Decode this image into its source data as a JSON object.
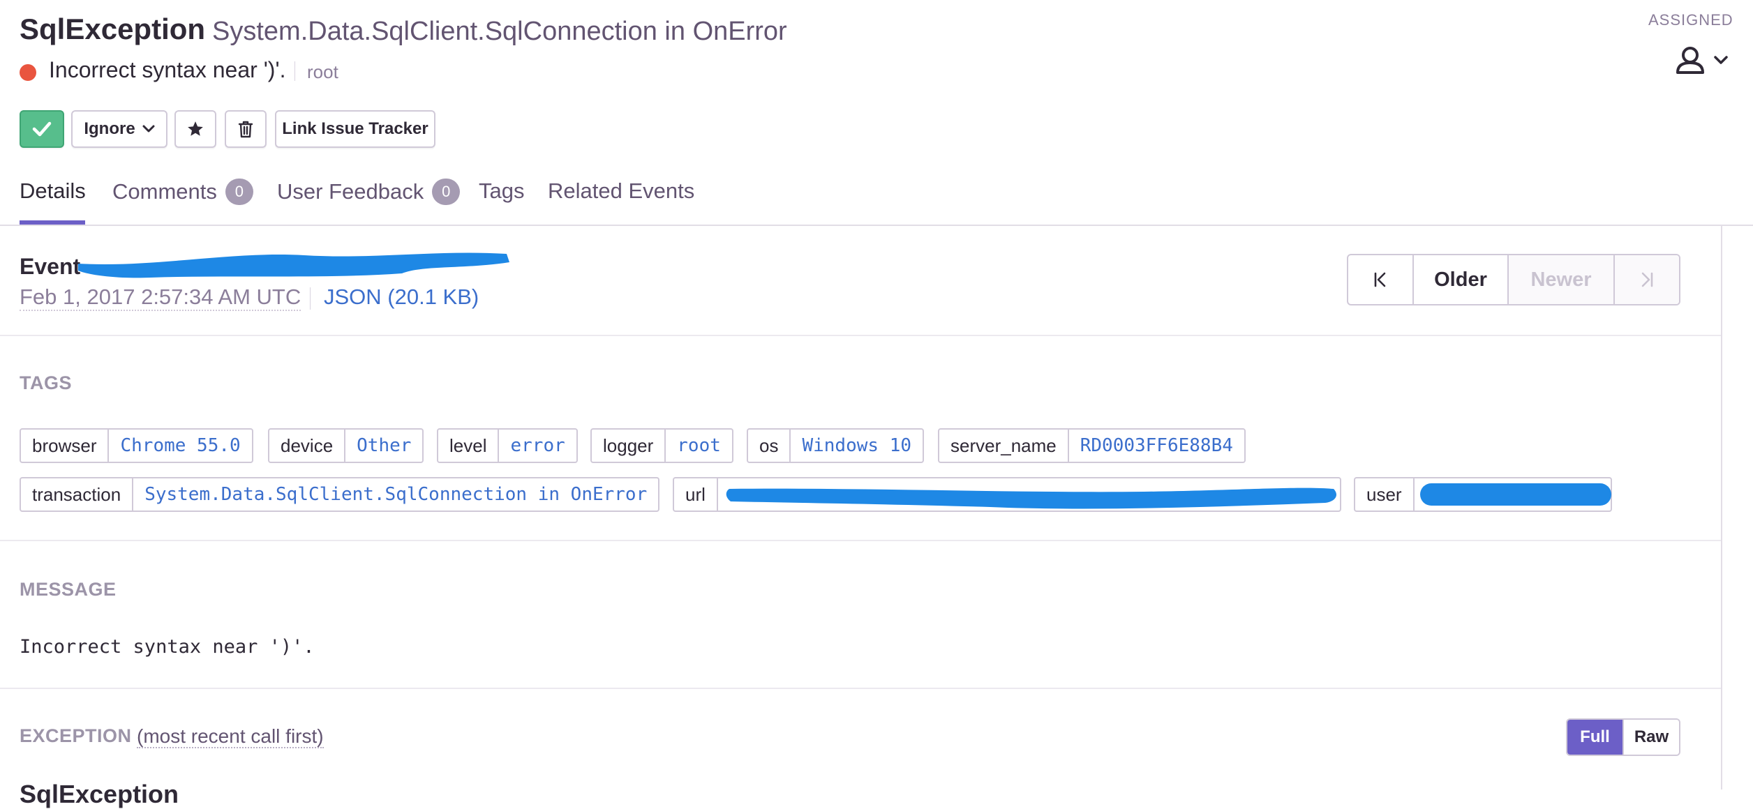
{
  "header": {
    "error_type": "SqlException",
    "culprit_title": "System.Data.SqlClient.SqlConnection in OnError",
    "message": "Incorrect syntax near ')'.",
    "logger": "root",
    "level_color": "#e9553f",
    "assigned_label": "ASSIGNED",
    "assignee_icon": "user-icon"
  },
  "actions": {
    "resolve_icon": "check-icon",
    "ignore_label": "Ignore",
    "bookmark_icon": "star-icon",
    "delete_icon": "trash-icon",
    "link_issue_label": "Link Issue Tracker",
    "resolve_color": "#57be8c"
  },
  "tabs": [
    {
      "label": "Details",
      "active": true
    },
    {
      "label": "Comments",
      "badge": "0"
    },
    {
      "label": "User Feedback",
      "badge": "0"
    },
    {
      "label": "Tags"
    },
    {
      "label": "Related Events"
    }
  ],
  "event": {
    "title": "Event",
    "date": "Feb 1, 2017 2:57:34 AM UTC",
    "json_link": "JSON (20.1 KB)",
    "pager": {
      "older": "Older",
      "newer": "Newer"
    }
  },
  "tags_section": {
    "title": "TAGS",
    "tags": [
      {
        "key": "browser",
        "value": "Chrome 55.0"
      },
      {
        "key": "device",
        "value": "Other"
      },
      {
        "key": "level",
        "value": "error"
      },
      {
        "key": "logger",
        "value": "root"
      },
      {
        "key": "os",
        "value": "Windows 10"
      },
      {
        "key": "server_name",
        "value": "RD0003FF6E88B4"
      },
      {
        "key": "transaction",
        "value": "System.Data.SqlClient.SqlConnection in OnError"
      },
      {
        "key": "url",
        "value": ""
      },
      {
        "key": "user",
        "value": ""
      }
    ]
  },
  "message_section": {
    "title": "MESSAGE",
    "text": "Incorrect syntax near ')'."
  },
  "exception_section": {
    "title": "EXCEPTION",
    "note": "(most recent call first)",
    "toggle": {
      "full": "Full",
      "raw": "Raw"
    },
    "cut_heading": "SqlException"
  }
}
